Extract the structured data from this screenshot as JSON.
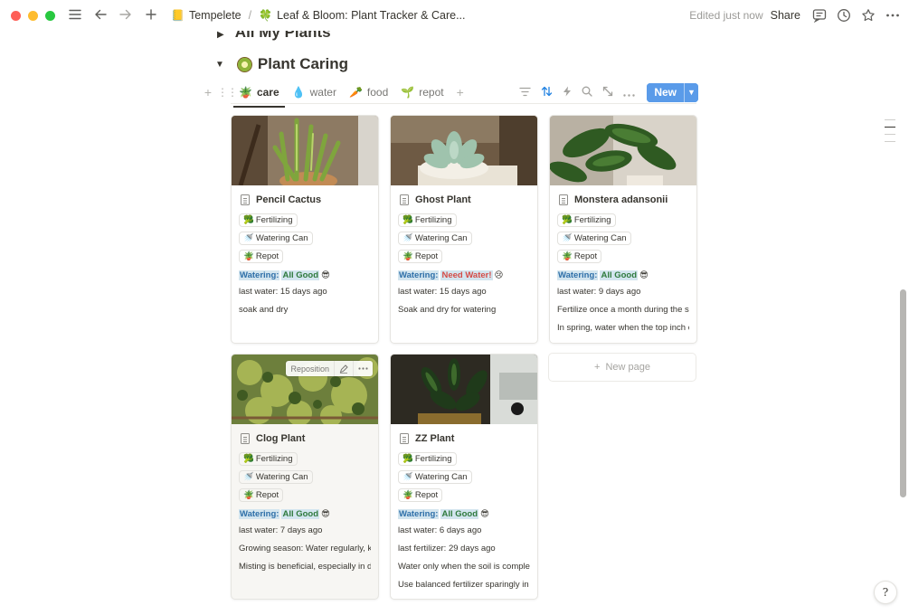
{
  "titlebar": {
    "breadcrumb": [
      {
        "icon": "notebook-icon",
        "glyph": "📒",
        "label": "Tempelete"
      },
      {
        "icon": "clover-icon",
        "glyph": "🍀",
        "label": "Leaf & Bloom: Plant Tracker & Care..."
      }
    ],
    "separator": "/",
    "edited": "Edited just now",
    "share": "Share"
  },
  "prev_section": {
    "title": "All My Plants"
  },
  "section": {
    "title": "Plant Caring",
    "tabs": [
      {
        "glyph": "🪴",
        "label": "care",
        "active": true
      },
      {
        "glyph": "💧",
        "label": "water",
        "active": false
      },
      {
        "glyph": "🥕",
        "label": "food",
        "active": false
      },
      {
        "glyph": "🌱",
        "label": "repot",
        "active": false
      }
    ],
    "new_button": "New"
  },
  "tag_labels": {
    "fertilizing": "Fertilizing",
    "watering_can": "Watering Can",
    "repot": "Repot"
  },
  "watering_label": "Watering:",
  "cards": [
    {
      "title": "Pencil Cactus",
      "status": "All Good",
      "status_emoji": "😎",
      "status_kind": "good",
      "lines": [
        "last water: 15 days ago",
        "soak and dry"
      ]
    },
    {
      "title": "Ghost Plant",
      "status": "Need Water!",
      "status_emoji": "😢",
      "status_kind": "need",
      "lines": [
        "last water: 15 days ago",
        "Soak and dry for watering"
      ]
    },
    {
      "title": "Monstera adansonii",
      "status": "All Good",
      "status_emoji": "😎",
      "status_kind": "good",
      "lines": [
        "last water: 9 days ago",
        "Fertilize once a month during the sp",
        "In spring, water when the top inch of"
      ]
    },
    {
      "title": "Clog Plant",
      "status": "All Good",
      "status_emoji": "😎",
      "status_kind": "good",
      "lines": [
        "last water: 7 days ago",
        "Growing season: Water regularly, kee",
        "Misting is beneficial, especially in dr"
      ]
    },
    {
      "title": "ZZ Plant",
      "status": "All Good",
      "status_emoji": "😎",
      "status_kind": "good",
      "lines": [
        "last water: 6 days ago",
        "last fertilizer: 29 days ago",
        "Water only when the soil is complete",
        "Use balanced fertilizer sparingly in s"
      ]
    }
  ],
  "reposition": "Reposition",
  "new_page": "New page",
  "help": "?"
}
